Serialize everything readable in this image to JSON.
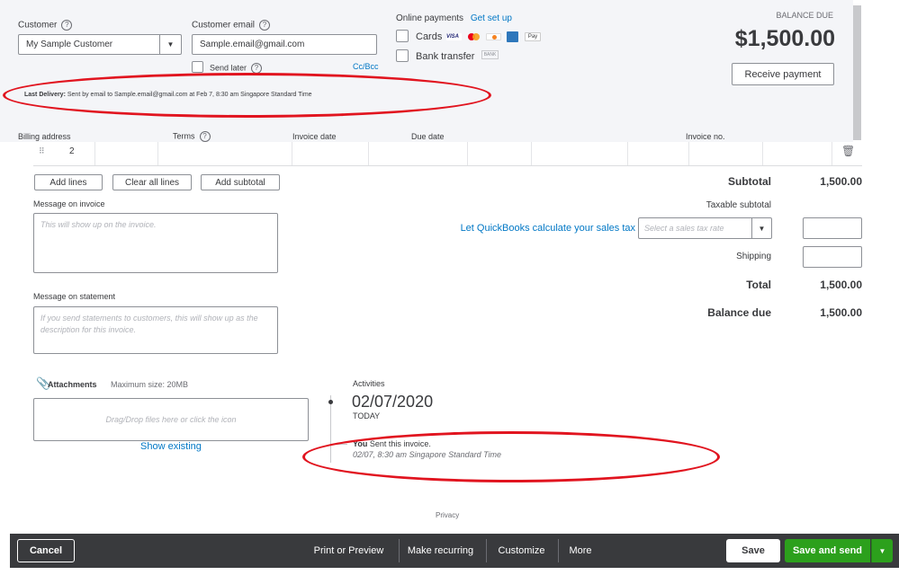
{
  "header": {
    "customer_label": "Customer",
    "customer_value": "My Sample Customer",
    "email_label": "Customer email",
    "email_value": "Sample.email@gmail.com",
    "send_later_label": "Send later",
    "cc_bcc": "Cc/Bcc",
    "online_payments_label": "Online payments",
    "get_set_up": "Get set up",
    "cards_label": "Cards",
    "bank_transfer_label": "Bank transfer",
    "bank_badge": "BANK",
    "balance_due_label": "BALANCE DUE",
    "balance_due_amount": "$1,500.00",
    "receive_payment": "Receive payment",
    "last_delivery_label": "Last Delivery:",
    "last_delivery_text": "Sent by email to Sample.email@gmail.com at Feb 7, 8:30 am Singapore Standard Time",
    "card_logos": [
      "VISA",
      "MC",
      "DISC",
      "AMEX",
      "Pay"
    ]
  },
  "columns": {
    "billing_address": "Billing address",
    "terms": "Terms",
    "invoice_date": "Invoice date",
    "due_date": "Due date",
    "invoice_no": "Invoice no."
  },
  "line_row": {
    "number": "2"
  },
  "line_actions": {
    "add_lines": "Add lines",
    "clear_all_lines": "Clear all lines",
    "add_subtotal": "Add subtotal"
  },
  "messages": {
    "invoice_label": "Message on invoice",
    "invoice_placeholder": "This will show up on the invoice.",
    "statement_label": "Message on statement",
    "statement_placeholder": "If you send statements to customers, this will show up as the description for this invoice."
  },
  "totals": {
    "subtotal_label": "Subtotal",
    "subtotal_value": "1,500.00",
    "taxable_subtotal_label": "Taxable subtotal",
    "tax_link": "Let QuickBooks calculate your sales tax",
    "tax_rate_placeholder": "Select a sales tax rate",
    "shipping_label": "Shipping",
    "total_label": "Total",
    "total_value": "1,500.00",
    "balance_due_label": "Balance due",
    "balance_due_value": "1,500.00"
  },
  "attachments": {
    "label": "Attachments",
    "max_size": "Maximum size: 20MB",
    "dropzone_text": "Drag/Drop files here or click the icon",
    "show_existing": "Show existing"
  },
  "activities": {
    "label": "Activities",
    "date": "02/07/2020",
    "today": "TODAY",
    "actor": "You",
    "action": "Sent this invoice.",
    "timestamp": "02/07, 8:30 am Singapore Standard Time"
  },
  "privacy": "Privacy",
  "footer": {
    "cancel": "Cancel",
    "print_or_preview": "Print or Preview",
    "make_recurring": "Make recurring",
    "customize": "Customize",
    "more": "More",
    "save": "Save",
    "save_and_send": "Save and send"
  },
  "colors": {
    "header_bg": "#f4f5f8",
    "link_blue": "#0077c5",
    "primary_green": "#2ca01c",
    "footer_bg": "#393a3d",
    "annotation_red": "#e1141f"
  }
}
